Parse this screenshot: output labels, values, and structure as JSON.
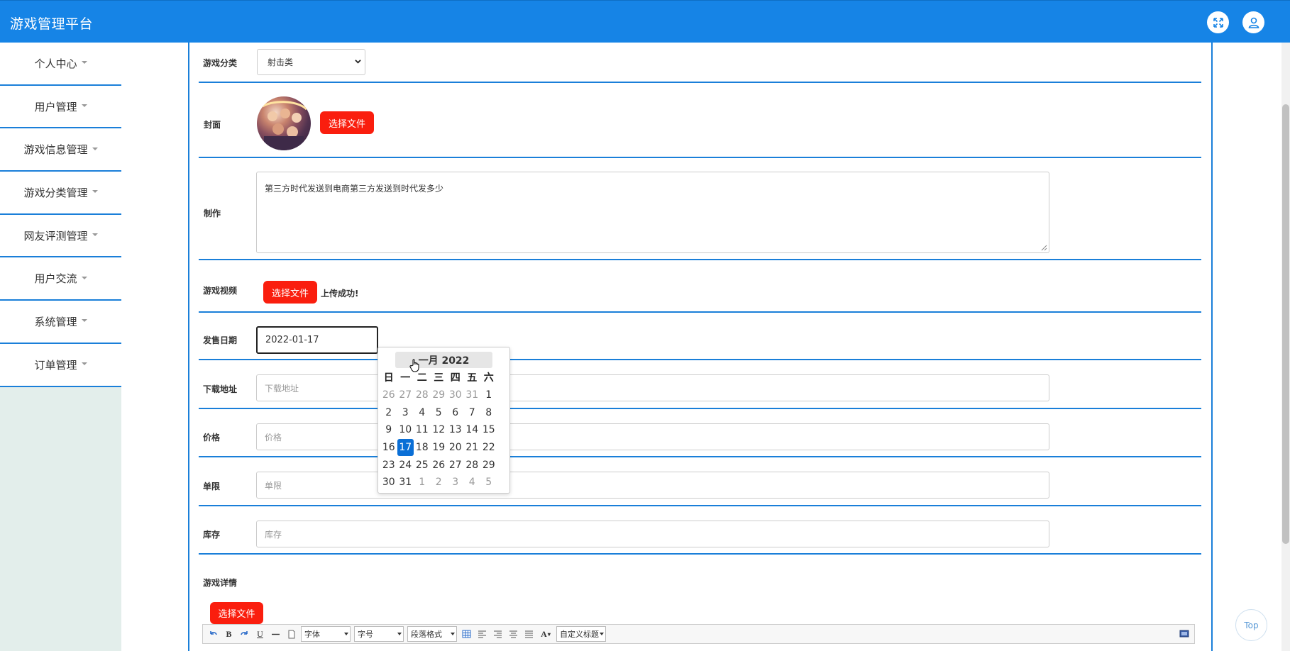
{
  "header": {
    "title": "游戏管理平台"
  },
  "sidebar": {
    "items": [
      {
        "label": "个人中心"
      },
      {
        "label": "用户管理"
      },
      {
        "label": "游戏信息管理"
      },
      {
        "label": "游戏分类管理"
      },
      {
        "label": "网友评测管理"
      },
      {
        "label": "用户交流"
      },
      {
        "label": "系统管理"
      },
      {
        "label": "订单管理"
      }
    ]
  },
  "form": {
    "category": {
      "label": "游戏分类",
      "value": "射击类"
    },
    "cover": {
      "label": "封面",
      "button": "选择文件"
    },
    "maker": {
      "label": "制作",
      "value": "第三方时代发送到电商第三方发送到时代发多少"
    },
    "video": {
      "label": "游戏视频",
      "button": "选择文件",
      "status": "上传成功!"
    },
    "release_date": {
      "label": "发售日期",
      "value": "2022-01-17"
    },
    "download": {
      "label": "下载地址",
      "placeholder": "下载地址"
    },
    "price": {
      "label": "价格",
      "placeholder": "价格"
    },
    "limit": {
      "label": "单限",
      "placeholder": "单限"
    },
    "stock": {
      "label": "库存",
      "placeholder": "库存"
    },
    "details": {
      "label": "游戏详情",
      "button": "选择文件"
    }
  },
  "calendar": {
    "title": "一月 2022",
    "weekdays": [
      "日",
      "一",
      "二",
      "三",
      "四",
      "五",
      "六"
    ],
    "weeks": [
      [
        "26",
        "27",
        "28",
        "29",
        "30",
        "31",
        "1"
      ],
      [
        "2",
        "3",
        "4",
        "5",
        "6",
        "7",
        "8"
      ],
      [
        "9",
        "10",
        "11",
        "12",
        "13",
        "14",
        "15"
      ],
      [
        "16",
        "17",
        "18",
        "19",
        "20",
        "21",
        "22"
      ],
      [
        "23",
        "24",
        "25",
        "26",
        "27",
        "28",
        "29"
      ],
      [
        "30",
        "31",
        "1",
        "2",
        "3",
        "4",
        "5"
      ]
    ],
    "selected": "17"
  },
  "editor": {
    "font_family": "字体",
    "font_size": "字号",
    "paragraph": "段落格式",
    "custom_title": "自定义标题"
  },
  "top_button": "Top",
  "colors": {
    "primary": "#1684e6",
    "danger": "#fa1e0e",
    "selected": "#0a6fd6",
    "sidebar_bg": "#e3eeeb"
  }
}
